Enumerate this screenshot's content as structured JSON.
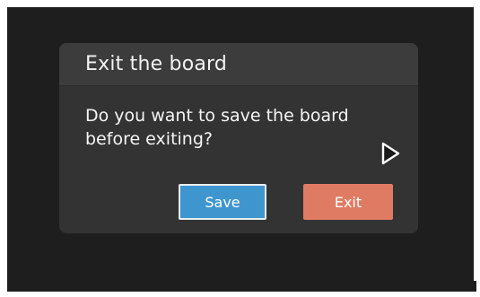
{
  "dialog": {
    "title": "Exit the board",
    "message": "Do you want to save the board before exiting?",
    "buttons": {
      "save_label": "Save",
      "exit_label": "Exit"
    }
  },
  "colors": {
    "background": "#1e1e1e",
    "dialog_body": "#333333",
    "dialog_header": "#3c3c3c",
    "save_button": "#3f96cf",
    "exit_button": "#e07b63"
  },
  "icons": {
    "pointer": "cursor-arrow-icon"
  }
}
